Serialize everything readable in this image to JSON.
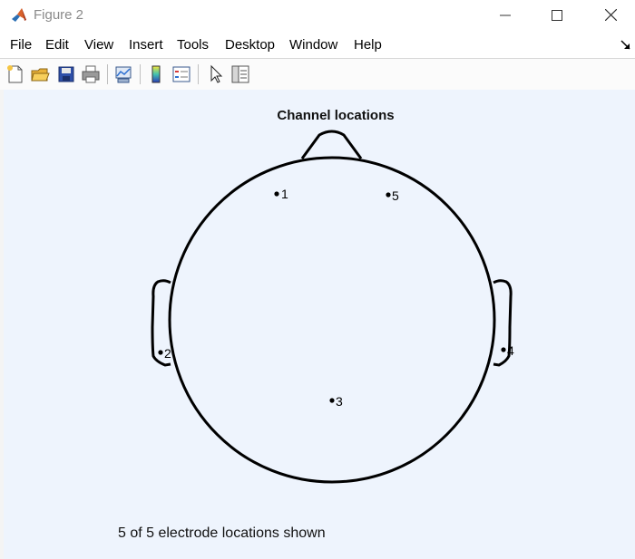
{
  "window": {
    "title": "Figure 2",
    "controls": [
      "minimize",
      "maximize",
      "close"
    ]
  },
  "menubar": {
    "items": [
      "File",
      "Edit",
      "View",
      "Insert",
      "Tools",
      "Desktop",
      "Window",
      "Help"
    ]
  },
  "toolbar": {
    "buttons": [
      "new-figure-icon",
      "open-file-icon",
      "save-icon",
      "print-icon",
      "link-plot-icon",
      "colorbar-icon",
      "legend-icon",
      "pointer-icon",
      "property-inspector-icon"
    ]
  },
  "figure": {
    "title": "Channel locations",
    "status": "5 of 5 electrode locations shown",
    "background": "#eef4fd",
    "head_color": "#000000"
  },
  "channels": [
    {
      "label": "1"
    },
    {
      "label": "2"
    },
    {
      "label": "3"
    },
    {
      "label": "4"
    },
    {
      "label": "5"
    }
  ]
}
